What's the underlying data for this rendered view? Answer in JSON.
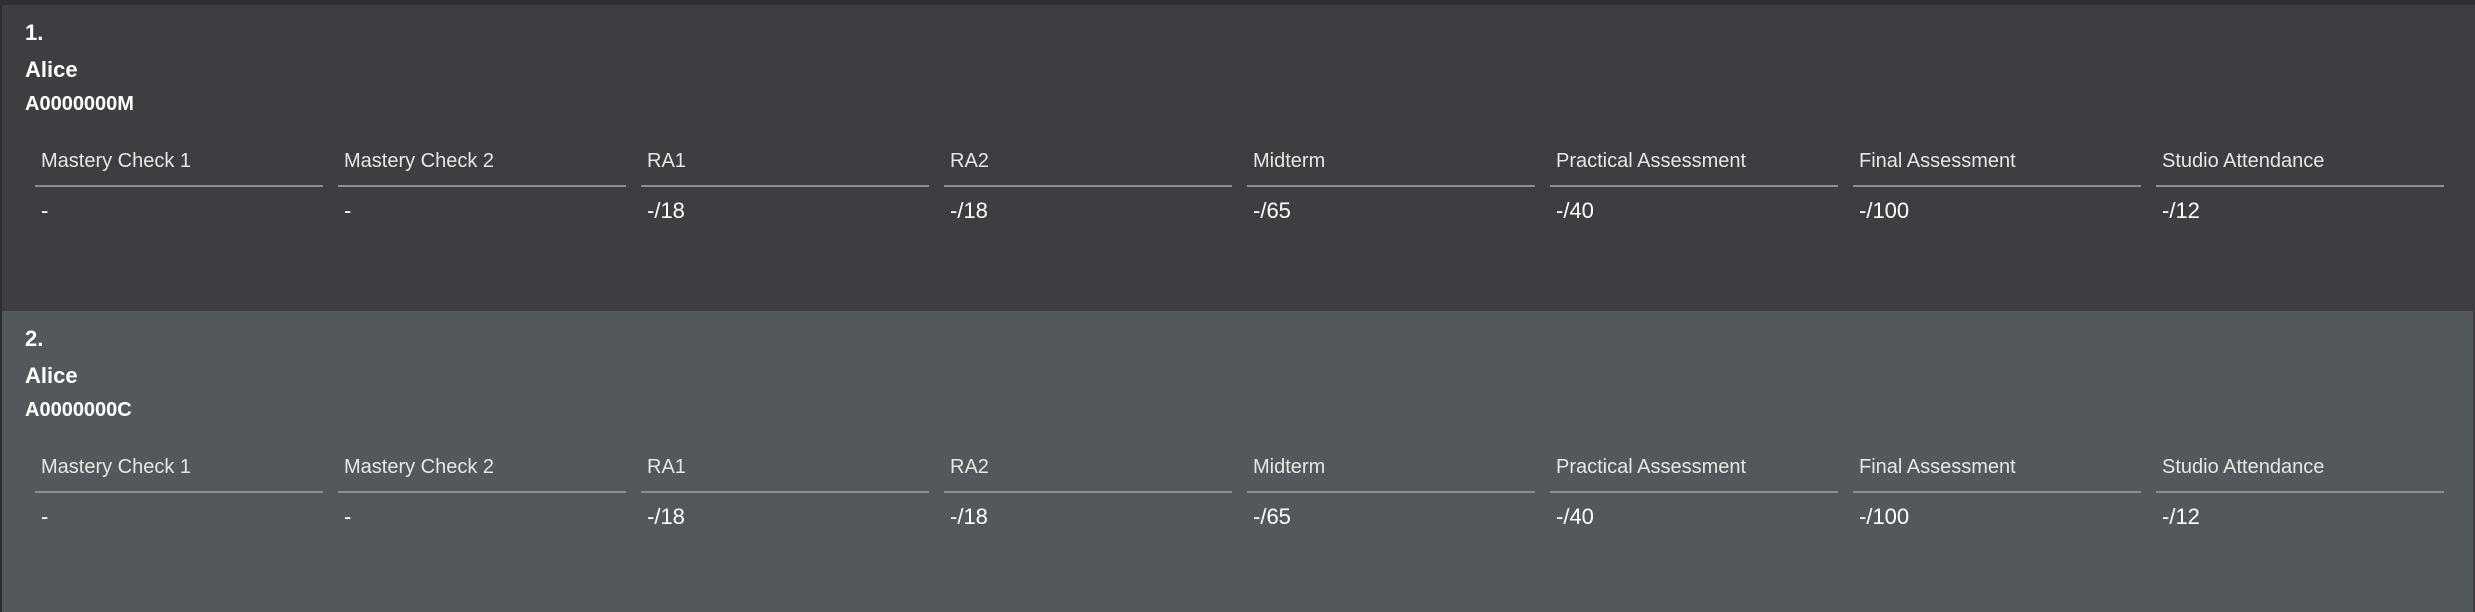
{
  "columns": [
    "Mastery Check 1",
    "Mastery Check 2",
    "RA1",
    "RA2",
    "Midterm",
    "Practical Assessment",
    "Final Assessment",
    "Studio Attendance"
  ],
  "students": [
    {
      "index": "1.",
      "name": "Alice",
      "id": "A0000000M",
      "grades": [
        "-",
        "-",
        "-/18",
        "-/18",
        "-/65",
        "-/40",
        "-/100",
        "-/12"
      ]
    },
    {
      "index": "2.",
      "name": "Alice",
      "id": "A0000000C",
      "grades": [
        "-",
        "-",
        "-/18",
        "-/18",
        "-/65",
        "-/40",
        "-/100",
        "-/12"
      ]
    }
  ],
  "colors": {
    "card_default": "#3c3e41",
    "card_selected": "#52585b",
    "text": "#ffffff",
    "rule": "#8b8f93"
  }
}
